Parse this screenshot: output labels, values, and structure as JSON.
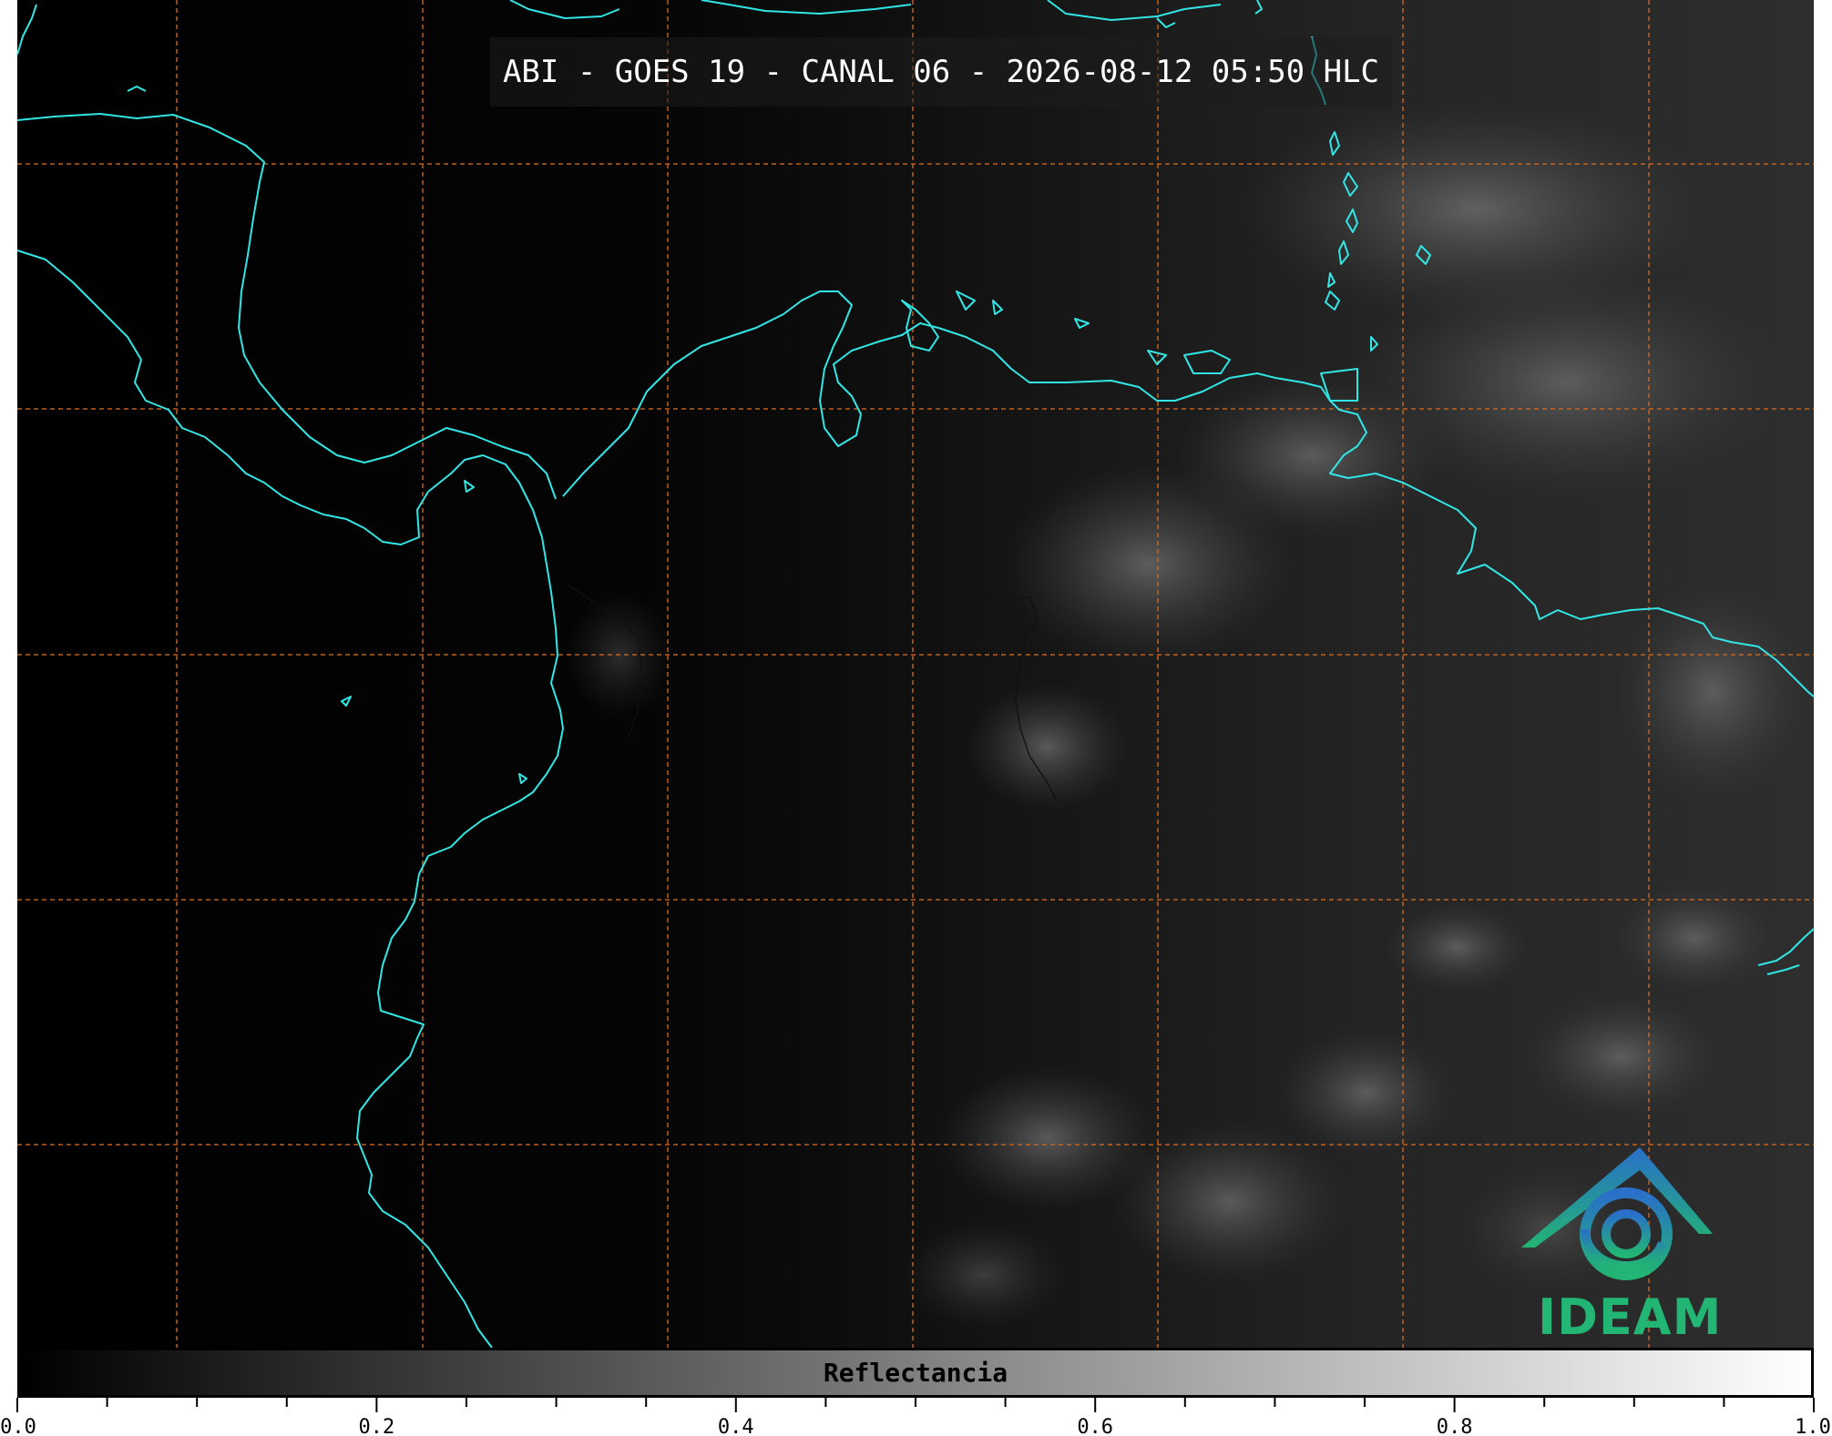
{
  "title": "ABI - GOES 19 - CANAL 06 - 2026-08-12 05:50 HLC",
  "colorbar": {
    "label": "Reflectancia",
    "ticks": [
      "0.0",
      "0.2",
      "0.4",
      "0.6",
      "0.8",
      "1.0"
    ],
    "range": [
      0.0,
      1.0
    ],
    "colormap": [
      "#000000",
      "#ffffff"
    ]
  },
  "map": {
    "coastline_color": "#32e6e6",
    "grid_color": "#d2691e",
    "grid_style": "dashed",
    "background": "#000000"
  },
  "logo": {
    "text": "IDEAM",
    "color_top": "#2a6fc9",
    "color_bottom": "#22b573"
  }
}
